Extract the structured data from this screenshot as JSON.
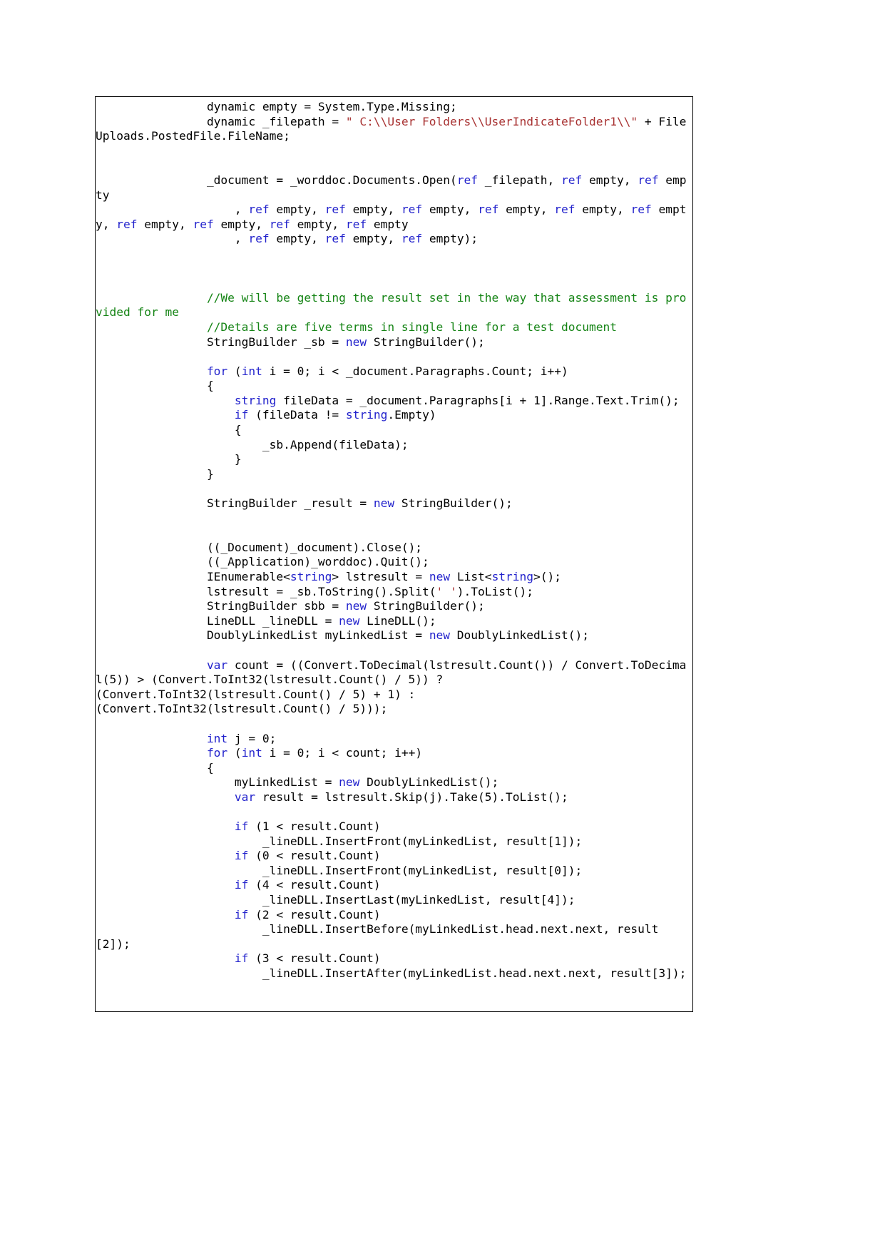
{
  "document": {
    "page_background": "#ffffff",
    "code_box": {
      "border_color": "#000000",
      "background": "#ffffff"
    },
    "colors": {
      "plain": "#000000",
      "keyword": "#2222CC",
      "string": "#A83232",
      "comment": "#158415"
    },
    "language": "csharp",
    "code_lines": [
      {
        "indent": "                ",
        "tokens": [
          {
            "t": "dynamic empty = System.Type.Missing;",
            "c": "pln"
          }
        ]
      },
      {
        "indent": "                ",
        "tokens": [
          {
            "t": "dynamic _filepath = ",
            "c": "pln"
          },
          {
            "t": "\" C:\\\\User Folders\\\\UserIndicateFolder1\\\\\"",
            "c": "str"
          },
          {
            "t": " + FileUploads.PostedFile.FileName;",
            "c": "pln"
          }
        ]
      },
      {
        "indent": "",
        "tokens": []
      },
      {
        "indent": "",
        "tokens": []
      },
      {
        "indent": "                ",
        "tokens": [
          {
            "t": "_document = _worddoc.Documents.Open(",
            "c": "pln"
          },
          {
            "t": "ref",
            "c": "kw"
          },
          {
            "t": " _filepath, ",
            "c": "pln"
          },
          {
            "t": "ref",
            "c": "kw"
          },
          {
            "t": " empty, ",
            "c": "pln"
          },
          {
            "t": "ref",
            "c": "kw"
          },
          {
            "t": " empty",
            "c": "pln"
          }
        ]
      },
      {
        "indent": "                    ",
        "tokens": [
          {
            "t": ", ",
            "c": "pln"
          },
          {
            "t": "ref",
            "c": "kw"
          },
          {
            "t": " empty, ",
            "c": "pln"
          },
          {
            "t": "ref",
            "c": "kw"
          },
          {
            "t": " empty, ",
            "c": "pln"
          },
          {
            "t": "ref",
            "c": "kw"
          },
          {
            "t": " empty, ",
            "c": "pln"
          },
          {
            "t": "ref",
            "c": "kw"
          },
          {
            "t": " empty, ",
            "c": "pln"
          },
          {
            "t": "ref",
            "c": "kw"
          },
          {
            "t": " empty, ",
            "c": "pln"
          },
          {
            "t": "ref",
            "c": "kw"
          },
          {
            "t": " empty, ",
            "c": "pln"
          },
          {
            "t": "ref",
            "c": "kw"
          },
          {
            "t": " empty, ",
            "c": "pln"
          },
          {
            "t": "ref",
            "c": "kw"
          },
          {
            "t": " empty, ",
            "c": "pln"
          },
          {
            "t": "ref",
            "c": "kw"
          },
          {
            "t": " empty, ",
            "c": "pln"
          },
          {
            "t": "ref",
            "c": "kw"
          },
          {
            "t": " empty",
            "c": "pln"
          }
        ]
      },
      {
        "indent": "                    ",
        "tokens": [
          {
            "t": ", ",
            "c": "pln"
          },
          {
            "t": "ref",
            "c": "kw"
          },
          {
            "t": " empty, ",
            "c": "pln"
          },
          {
            "t": "ref",
            "c": "kw"
          },
          {
            "t": " empty, ",
            "c": "pln"
          },
          {
            "t": "ref",
            "c": "kw"
          },
          {
            "t": " empty);",
            "c": "pln"
          }
        ]
      },
      {
        "indent": "",
        "tokens": []
      },
      {
        "indent": "",
        "tokens": []
      },
      {
        "indent": "",
        "tokens": []
      },
      {
        "indent": "                ",
        "tokens": [
          {
            "t": "//We will be getting the result set in the way that assessment is provided for me",
            "c": "cmt"
          }
        ]
      },
      {
        "indent": "                ",
        "tokens": [
          {
            "t": "//Details are five terms in single line for a test document",
            "c": "cmt"
          }
        ]
      },
      {
        "indent": "                ",
        "tokens": [
          {
            "t": "StringBuilder _sb = ",
            "c": "pln"
          },
          {
            "t": "new",
            "c": "kw"
          },
          {
            "t": " StringBuilder();",
            "c": "pln"
          }
        ]
      },
      {
        "indent": "",
        "tokens": []
      },
      {
        "indent": "                ",
        "tokens": [
          {
            "t": "for",
            "c": "kw"
          },
          {
            "t": " (",
            "c": "pln"
          },
          {
            "t": "int",
            "c": "kw"
          },
          {
            "t": " i = 0; i < _document.Paragraphs.Count; i++)",
            "c": "pln"
          }
        ]
      },
      {
        "indent": "                ",
        "tokens": [
          {
            "t": "{",
            "c": "pln"
          }
        ]
      },
      {
        "indent": "                    ",
        "tokens": [
          {
            "t": "string",
            "c": "kw"
          },
          {
            "t": " fileData = _document.Paragraphs[i + 1].Range.Text.Trim();",
            "c": "pln"
          }
        ]
      },
      {
        "indent": "                    ",
        "tokens": [
          {
            "t": "if",
            "c": "kw"
          },
          {
            "t": " (fileData != ",
            "c": "pln"
          },
          {
            "t": "string",
            "c": "kw"
          },
          {
            "t": ".Empty)",
            "c": "pln"
          }
        ]
      },
      {
        "indent": "                    ",
        "tokens": [
          {
            "t": "{",
            "c": "pln"
          }
        ]
      },
      {
        "indent": "                        ",
        "tokens": [
          {
            "t": "_sb.Append(fileData);",
            "c": "pln"
          }
        ]
      },
      {
        "indent": "                    ",
        "tokens": [
          {
            "t": "}",
            "c": "pln"
          }
        ]
      },
      {
        "indent": "                ",
        "tokens": [
          {
            "t": "}",
            "c": "pln"
          }
        ]
      },
      {
        "indent": "",
        "tokens": []
      },
      {
        "indent": "                ",
        "tokens": [
          {
            "t": "StringBuilder _result = ",
            "c": "pln"
          },
          {
            "t": "new",
            "c": "kw"
          },
          {
            "t": " StringBuilder();",
            "c": "pln"
          }
        ]
      },
      {
        "indent": "",
        "tokens": []
      },
      {
        "indent": "",
        "tokens": []
      },
      {
        "indent": "                ",
        "tokens": [
          {
            "t": "((_Document)_document).Close();",
            "c": "pln"
          }
        ]
      },
      {
        "indent": "                ",
        "tokens": [
          {
            "t": "((_Application)_worddoc).Quit();",
            "c": "pln"
          }
        ]
      },
      {
        "indent": "                ",
        "tokens": [
          {
            "t": "IEnumerable<",
            "c": "pln"
          },
          {
            "t": "string",
            "c": "kw"
          },
          {
            "t": "> lstresult = ",
            "c": "pln"
          },
          {
            "t": "new",
            "c": "kw"
          },
          {
            "t": " List<",
            "c": "pln"
          },
          {
            "t": "string",
            "c": "kw"
          },
          {
            "t": ">();",
            "c": "pln"
          }
        ]
      },
      {
        "indent": "                ",
        "tokens": [
          {
            "t": "lstresult = _sb.ToString().Split(",
            "c": "pln"
          },
          {
            "t": "' '",
            "c": "str"
          },
          {
            "t": ").ToList();",
            "c": "pln"
          }
        ]
      },
      {
        "indent": "                ",
        "tokens": [
          {
            "t": "StringBuilder sbb = ",
            "c": "pln"
          },
          {
            "t": "new",
            "c": "kw"
          },
          {
            "t": " StringBuilder();",
            "c": "pln"
          }
        ]
      },
      {
        "indent": "                ",
        "tokens": [
          {
            "t": "LineDLL _lineDLL = ",
            "c": "pln"
          },
          {
            "t": "new",
            "c": "kw"
          },
          {
            "t": " LineDLL();",
            "c": "pln"
          }
        ]
      },
      {
        "indent": "                ",
        "tokens": [
          {
            "t": "DoublyLinkedList myLinkedList = ",
            "c": "pln"
          },
          {
            "t": "new",
            "c": "kw"
          },
          {
            "t": " DoublyLinkedList();",
            "c": "pln"
          }
        ]
      },
      {
        "indent": "",
        "tokens": []
      },
      {
        "indent": "                ",
        "tokens": [
          {
            "t": "var",
            "c": "kw"
          },
          {
            "t": " count = ((Convert.ToDecimal(lstresult.Count()) / Convert.ToDecimal(5)) > (Convert.ToInt32(lstresult.Count() / 5)) ?",
            "c": "pln"
          }
        ]
      },
      {
        "indent": "",
        "tokens": [
          {
            "t": "(Convert.ToInt32(lstresult.Count() / 5) + 1) :",
            "c": "pln"
          }
        ]
      },
      {
        "indent": "",
        "tokens": [
          {
            "t": "(Convert.ToInt32(lstresult.Count() / 5)));",
            "c": "pln"
          }
        ]
      },
      {
        "indent": "",
        "tokens": []
      },
      {
        "indent": "                ",
        "tokens": [
          {
            "t": "int",
            "c": "kw"
          },
          {
            "t": " j = 0;",
            "c": "pln"
          }
        ]
      },
      {
        "indent": "                ",
        "tokens": [
          {
            "t": "for",
            "c": "kw"
          },
          {
            "t": " (",
            "c": "pln"
          },
          {
            "t": "int",
            "c": "kw"
          },
          {
            "t": " i = 0; i < count; i++)",
            "c": "pln"
          }
        ]
      },
      {
        "indent": "                ",
        "tokens": [
          {
            "t": "{",
            "c": "pln"
          }
        ]
      },
      {
        "indent": "                    ",
        "tokens": [
          {
            "t": "myLinkedList = ",
            "c": "pln"
          },
          {
            "t": "new",
            "c": "kw"
          },
          {
            "t": " DoublyLinkedList();",
            "c": "pln"
          }
        ]
      },
      {
        "indent": "                    ",
        "tokens": [
          {
            "t": "var",
            "c": "kw"
          },
          {
            "t": " result = lstresult.Skip(j).Take(5).ToList();",
            "c": "pln"
          }
        ]
      },
      {
        "indent": "",
        "tokens": []
      },
      {
        "indent": "                    ",
        "tokens": [
          {
            "t": "if",
            "c": "kw"
          },
          {
            "t": " (1 < result.Count)",
            "c": "pln"
          }
        ]
      },
      {
        "indent": "                        ",
        "tokens": [
          {
            "t": "_lineDLL.InsertFront(myLinkedList, result[1]);",
            "c": "pln"
          }
        ]
      },
      {
        "indent": "                    ",
        "tokens": [
          {
            "t": "if",
            "c": "kw"
          },
          {
            "t": " (0 < result.Count)",
            "c": "pln"
          }
        ]
      },
      {
        "indent": "                        ",
        "tokens": [
          {
            "t": "_lineDLL.InsertFront(myLinkedList, result[0]);",
            "c": "pln"
          }
        ]
      },
      {
        "indent": "                    ",
        "tokens": [
          {
            "t": "if",
            "c": "kw"
          },
          {
            "t": " (4 < result.Count)",
            "c": "pln"
          }
        ]
      },
      {
        "indent": "                        ",
        "tokens": [
          {
            "t": "_lineDLL.InsertLast(myLinkedList, result[4]);",
            "c": "pln"
          }
        ]
      },
      {
        "indent": "                    ",
        "tokens": [
          {
            "t": "if",
            "c": "kw"
          },
          {
            "t": " (2 < result.Count)",
            "c": "pln"
          }
        ]
      },
      {
        "indent": "                        ",
        "tokens": [
          {
            "t": "_lineDLL.InsertBefore(myLinkedList.head.next.next, result[2]);",
            "c": "pln"
          }
        ]
      },
      {
        "indent": "                    ",
        "tokens": [
          {
            "t": "if",
            "c": "kw"
          },
          {
            "t": " (3 < result.Count)",
            "c": "pln"
          }
        ]
      },
      {
        "indent": "                        ",
        "tokens": [
          {
            "t": "_lineDLL.InsertAfter(myLinkedList.head.next.next, result[3]);",
            "c": "pln"
          }
        ]
      }
    ]
  }
}
